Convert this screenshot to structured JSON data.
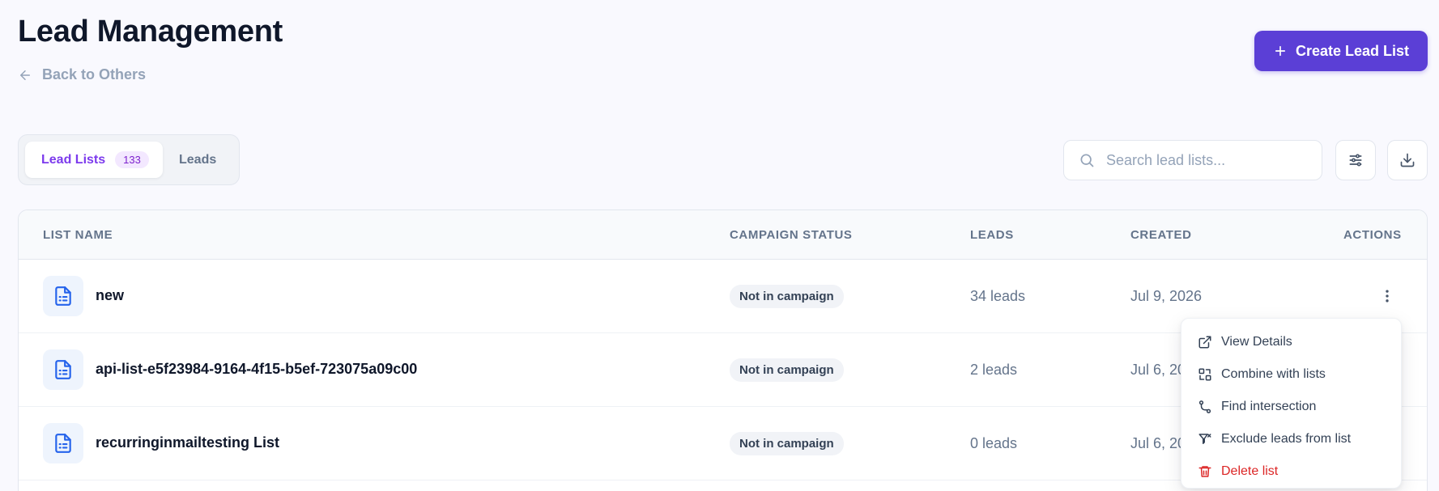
{
  "header": {
    "title": "Lead Management",
    "back_label": "Back to Others",
    "create_label": "Create Lead List"
  },
  "tabs": [
    {
      "label": "Lead Lists",
      "count": "133",
      "active": true
    },
    {
      "label": "Leads",
      "active": false
    }
  ],
  "search": {
    "placeholder": "Search lead lists...",
    "value": ""
  },
  "toolbar": {
    "filter_icon": "sliders-icon",
    "download_icon": "download-icon"
  },
  "table": {
    "columns": [
      "LIST NAME",
      "CAMPAIGN STATUS",
      "LEADS",
      "CREATED",
      "ACTIONS"
    ],
    "rows": [
      {
        "name": "new",
        "status": "Not in campaign",
        "leads": "34 leads",
        "created": "Jul 9, 2026"
      },
      {
        "name": "api-list-e5f23984-9164-4f15-b5ef-723075a09c00",
        "status": "Not in campaign",
        "leads": "2 leads",
        "created": "Jul 6, 2026"
      },
      {
        "name": "recurringinmailtesting List",
        "status": "Not in campaign",
        "leads": "0 leads",
        "created": "Jul 6, 2026"
      }
    ]
  },
  "actions_menu": {
    "items": [
      {
        "label": "View Details",
        "icon": "external-link-icon"
      },
      {
        "label": "Combine with lists",
        "icon": "combine-icon"
      },
      {
        "label": "Find intersection",
        "icon": "git-merge-icon"
      },
      {
        "label": "Exclude leads from list",
        "icon": "filter-x-icon"
      },
      {
        "label": "Delete list",
        "icon": "trash-icon",
        "danger": true
      }
    ]
  },
  "colors": {
    "primary": "#5b3fd6",
    "tab_active": "#7c3aed",
    "file_icon": "#2563eb",
    "danger": "#dc2626",
    "background": "#f9f9fe"
  }
}
